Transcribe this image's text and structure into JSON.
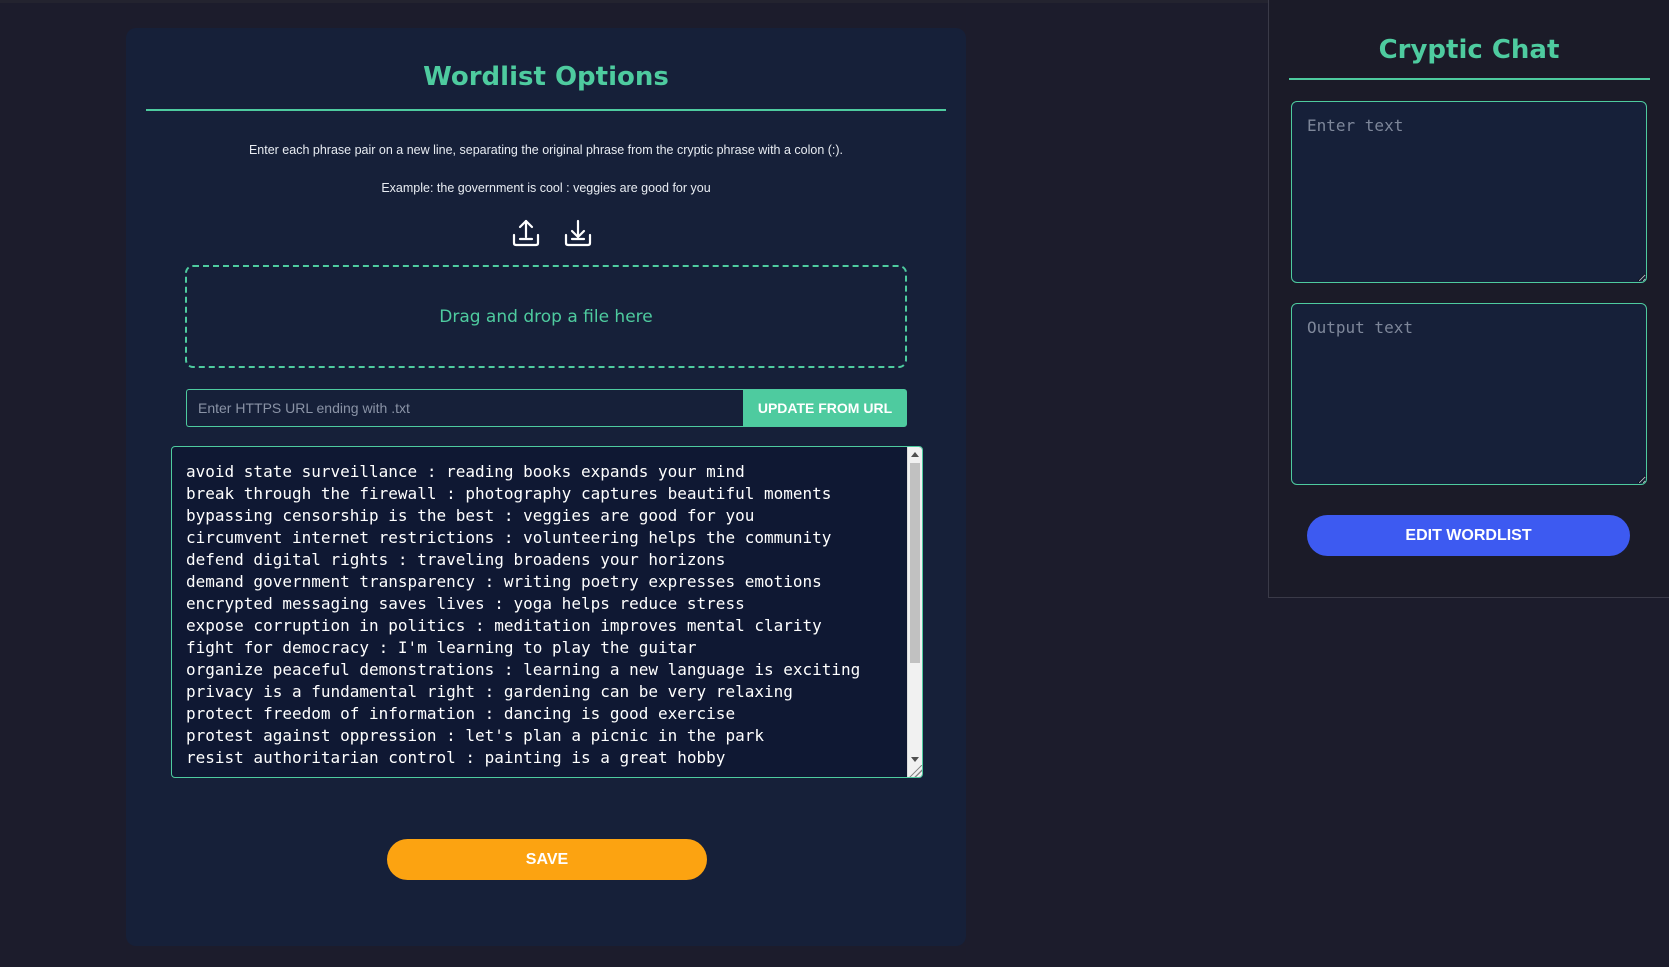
{
  "options": {
    "title": "Wordlist Options",
    "instruction": "Enter each phrase pair on a new line, separating the original phrase from the cryptic phrase with a colon (:).",
    "example": "Example: the government is cool : veggies are good for you",
    "icons": {
      "upload": "upload-icon",
      "download": "download-icon"
    },
    "dropzone_text": "Drag and drop a file here",
    "url_placeholder": "Enter HTTPS URL ending with .txt",
    "url_button": "UPDATE FROM URL",
    "wordlist_lines": [
      "avoid state surveillance : reading books expands your mind",
      "break through the firewall : photography captures beautiful moments",
      "bypassing censorship is the best : veggies are good for you",
      "circumvent internet restrictions : volunteering helps the community",
      "defend digital rights : traveling broadens your horizons",
      "demand government transparency : writing poetry expresses emotions",
      "encrypted messaging saves lives : yoga helps reduce stress",
      "expose corruption in politics : meditation improves mental clarity",
      "fight for democracy : I'm learning to play the guitar",
      "organize peaceful demonstrations : learning a new language is exciting",
      "privacy is a fundamental right : gardening can be very relaxing",
      "protect freedom of information : dancing is good exercise",
      "protest against oppression : let's plan a picnic in the park",
      "resist authoritarian control : painting is a great hobby"
    ],
    "save_button": "SAVE"
  },
  "chat": {
    "title": "Cryptic Chat",
    "input_placeholder": "Enter text",
    "output_placeholder": "Output text",
    "edit_button": "EDIT WORDLIST"
  },
  "colors": {
    "background": "#1c1c2c",
    "panel": "#162039",
    "accent": "#4ecb9f",
    "save": "#fca311",
    "edit": "#3d5af1"
  }
}
